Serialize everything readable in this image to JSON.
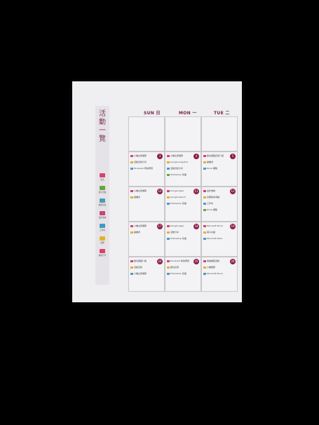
{
  "sidebar": {
    "title": "活動一覽",
    "legend": [
      {
        "label": "藝文",
        "icon": "pen-icon",
        "color": "#d8436a"
      },
      {
        "label": "親子活動",
        "icon": "star-icon",
        "color": "#6aa33a"
      },
      {
        "label": "戲劇演出",
        "icon": "tea-icon",
        "color": "#4a9db5"
      },
      {
        "label": "電影放映",
        "icon": "film-icon",
        "color": "#c2477a"
      },
      {
        "label": "工作坊",
        "icon": "tool-icon",
        "color": "#3a9bc9"
      },
      {
        "label": "展覽",
        "icon": "frame-icon",
        "color": "#e0b42a"
      },
      {
        "label": "講座分享",
        "icon": "pencil-icon",
        "color": "#d8436a"
      }
    ]
  },
  "days": [
    "SUN 日",
    "MON 一",
    "TUE 二"
  ],
  "weeks": [
    {
      "cells": [
        {
          "num": "",
          "events": []
        },
        {
          "num": "",
          "events": []
        },
        {
          "num": "",
          "events": []
        }
      ]
    },
    {
      "cells": [
        {
          "num": "3",
          "events": [
            "小書主題展覽",
            "活動資訊分享",
            "Facebook 粉絲專頁"
          ]
        },
        {
          "num": "4",
          "events": [
            "小書主題展覽",
            "Google Analytics",
            "活動資訊分享",
            "Photoshop 基礎"
          ]
        },
        {
          "num": "5",
          "events": [
            "數位典藏資源介紹",
            "讀書會",
            "Excel 課程"
          ]
        }
      ]
    },
    {
      "cells": [
        {
          "num": "10",
          "events": [
            "小書主題展覽",
            "讀書會"
          ]
        },
        {
          "num": "11",
          "events": [
            "Google Apps",
            "Google Search",
            "Photoshop 基礎"
          ]
        },
        {
          "num": "12",
          "events": [
            "電影放映",
            "兒童繪本導讀",
            "工作坊",
            "Excel 課程"
          ]
        }
      ]
    },
    {
      "cells": [
        {
          "num": "17",
          "events": [
            "小書主題展覽",
            "讀書會"
          ]
        },
        {
          "num": "18",
          "events": [
            "Google Apps",
            "活動分享",
            "Photoshop 基礎"
          ]
        },
        {
          "num": "19",
          "events": [
            "Microsoft Excel",
            "親子共讀",
            "Microsoft Word"
          ]
        }
      ]
    },
    {
      "cells": [
        {
          "num": "24",
          "events": [
            "數位典藏介紹",
            "活動資訊",
            "小書主題展覽"
          ]
        },
        {
          "num": "25",
          "events": [
            "Facebook 粉絲專頁",
            "數位資源",
            "Photoshop 基礎"
          ]
        },
        {
          "num": "26",
          "events": [
            "閱讀推廣活動",
            "小書展覽",
            "Microsoft Excel"
          ]
        }
      ]
    }
  ]
}
